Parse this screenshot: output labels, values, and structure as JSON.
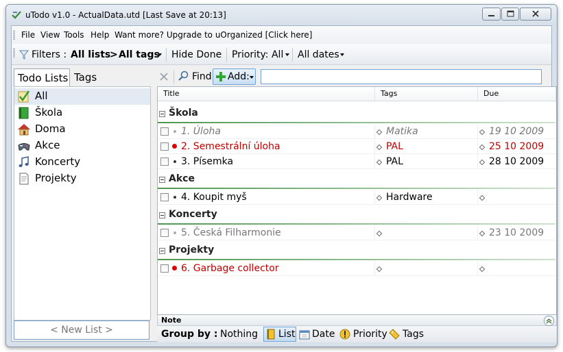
{
  "window": {
    "title": "uTodo v1.0 - ActualData.utd   [Last Save at 20:13]"
  },
  "menu": {
    "items": [
      "File",
      "View",
      "Tools",
      "Help",
      "Want more? Upgrade to uOrganized [Click here]"
    ]
  },
  "toolbar": {
    "filters_label": "Filters :",
    "all_lists": "All lists",
    "separator": ">",
    "all_tags": "All tags",
    "hide_done": "Hide Done",
    "priority": "Priority: All",
    "dates": "All dates"
  },
  "sidebar": {
    "tabs": [
      "Todo Lists",
      "Tags"
    ],
    "items": [
      {
        "label": "All",
        "icon": "checklist-icon"
      },
      {
        "label": "Škola",
        "icon": "book-icon"
      },
      {
        "label": "Doma",
        "icon": "house-icon"
      },
      {
        "label": "Akce",
        "icon": "gamepad-icon"
      },
      {
        "label": "Koncerty",
        "icon": "music-note-icon"
      },
      {
        "label": "Projekty",
        "icon": "document-icon"
      }
    ],
    "new_list": "< New List >"
  },
  "task_toolbar": {
    "find": "Find",
    "add": "Add:"
  },
  "grid": {
    "columns": [
      "Title",
      "Tags",
      "Due"
    ],
    "groups": [
      {
        "name": "Škola",
        "tasks": [
          {
            "title": "1. Úloha",
            "tags": "Matika",
            "due": "19 10 2009",
            "style": "gray"
          },
          {
            "title": "2. Semestrální úloha",
            "tags": "PAL",
            "due": "25 10 2009",
            "style": "red"
          },
          {
            "title": "3. Písemka",
            "tags": "PAL",
            "due": "28 10 2009",
            "style": "black"
          }
        ]
      },
      {
        "name": "Akce",
        "tasks": [
          {
            "title": "4. Koupit myš",
            "tags": "Hardware",
            "due": "",
            "style": "black"
          }
        ]
      },
      {
        "name": "Koncerty",
        "tasks": [
          {
            "title": "5. Česká Filharmonie",
            "tags": "",
            "due": "23 10 2009",
            "style": "plain-gray"
          }
        ]
      },
      {
        "name": "Projekty",
        "tasks": [
          {
            "title": "6. Garbage collector",
            "tags": "",
            "due": "",
            "style": "red"
          }
        ]
      }
    ]
  },
  "note": {
    "label": "Note"
  },
  "group_by": {
    "label": "Group by :",
    "options": [
      "Nothing",
      "List",
      "Date",
      "Priority",
      "Tags"
    ],
    "selected": "List"
  },
  "colors": {
    "accent_blue": "#6fa3d6",
    "group_green": "#4e9650",
    "overdue_red": "#c00000"
  }
}
